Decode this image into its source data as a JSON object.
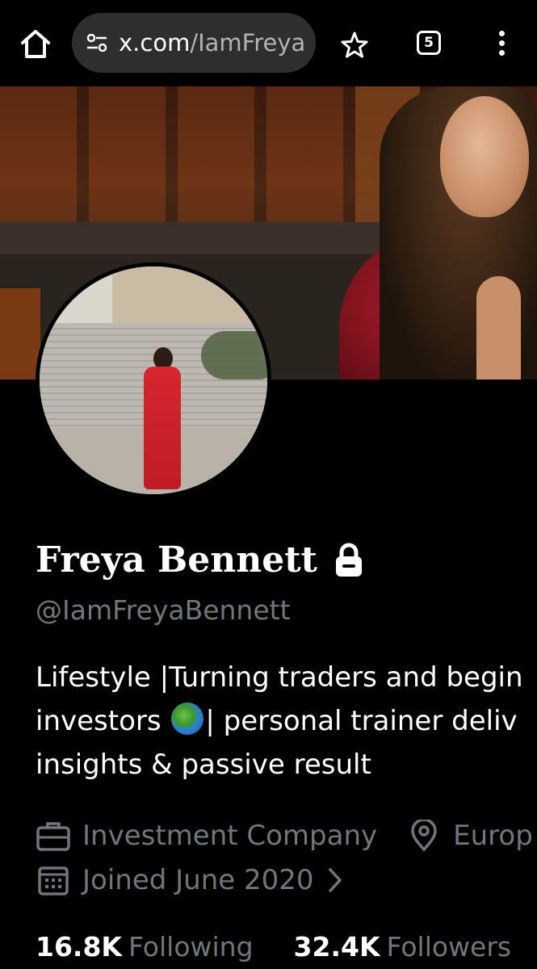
{
  "browser": {
    "url_domain": "x.com",
    "url_path": "/IamFreya",
    "tab_count": "5",
    "icons": [
      "home-icon",
      "site-settings-icon",
      "bookmark-star-icon",
      "tabs-icon",
      "menu-icon"
    ]
  },
  "profile": {
    "display_name": "Freya Bennett",
    "handle": "@IamFreyaBennett",
    "bio_lines": [
      "Lifestyle |Turning traders and begin",
      "investors",
      "| personal trainer deliv",
      "insights & passive result"
    ],
    "category": "Investment Company",
    "location": "Europ",
    "joined": "Joined June 2020",
    "following_count": "16.8K",
    "following_label": "Following",
    "followers_count": "32.4K",
    "followers_label": "Followers"
  },
  "colors": {
    "background": "#000000",
    "secondary_text": "#71767b",
    "url_bar": "#2d2e30"
  }
}
